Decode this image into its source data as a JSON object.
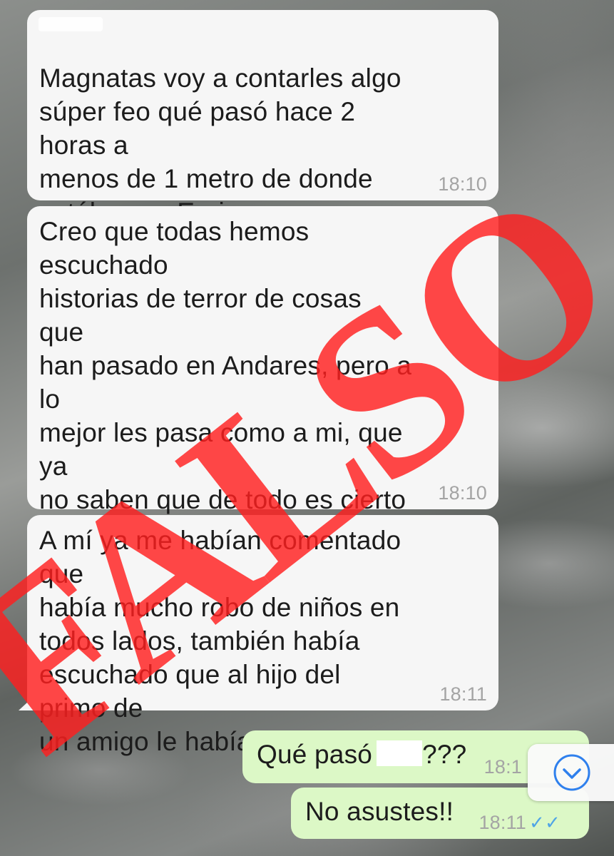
{
  "messages": [
    {
      "direction": "incoming",
      "text": "Magnatas voy a contarles algo\nsúper feo qué pasó hace 2 horas a\nmenos de 1 metro de donde\nestábamos Enrique y yo",
      "time": "18:10"
    },
    {
      "direction": "incoming",
      "text": "Creo que todas hemos escuchado\nhistorias de terror de cosas que\nhan pasado en Andares, pero a lo\nmejor les pasa como a mi, que ya\nno saben que de todo es cierto y\nque no, y no se si decidimos\ntaparnos los ojos para seguir\nadelante",
      "time": "18:10"
    },
    {
      "direction": "incoming",
      "text": "A mí ya me habían comentado que\nhabía mucho robo de niños en\ntodos lados, también había\nescuchado que al hijo del primo de\nun amigo le había pasado etc",
      "time": "18:11"
    },
    {
      "direction": "outgoing",
      "text_before": "Qué pasó",
      "text_after": "???",
      "time": "18:1"
    },
    {
      "direction": "outgoing",
      "text": "No asustes!!",
      "time": "18:11",
      "status_icon": "double-check-icon"
    }
  ],
  "overlay_stamp": {
    "text": "FALSO",
    "color": "#ff1e1e"
  },
  "scroll_button": {
    "icon": "chevron-down-icon",
    "color": "#2f80ed"
  }
}
